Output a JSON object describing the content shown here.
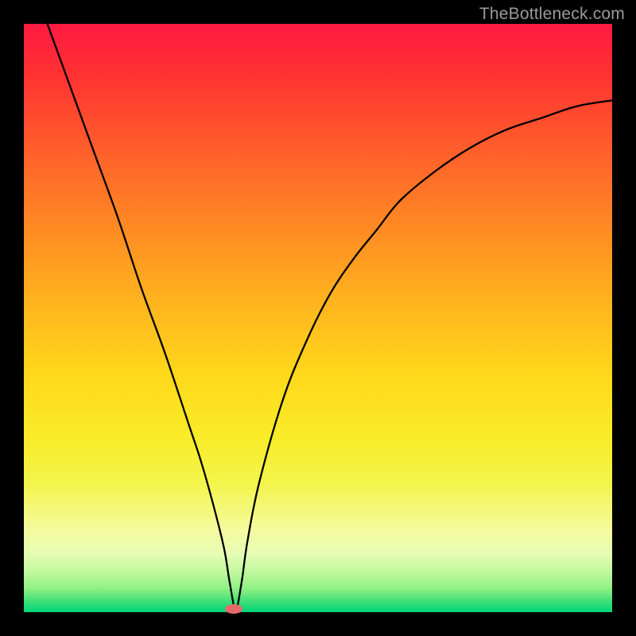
{
  "watermark": "TheBottleneck.com",
  "colors": {
    "frame": "#000000",
    "gradient_top": "#ff1a43",
    "gradient_bottom": "#00d577",
    "curve": "#000000",
    "marker": "#e46a6a",
    "watermark_text": "#9a9a9a"
  },
  "chart_data": {
    "type": "line",
    "title": "",
    "xlabel": "",
    "ylabel": "",
    "xlim": [
      0,
      100
    ],
    "ylim": [
      0,
      100
    ],
    "grid": false,
    "legend": false,
    "comment": "Values read from the image as percentage of plot area (x left→right, y bottom→top). Background color maps y=0→green, y=100→red.",
    "series": [
      {
        "name": "curve",
        "color": "#000000",
        "x": [
          4,
          8,
          12,
          16,
          20,
          24,
          28,
          30,
          32,
          34,
          35,
          36,
          37,
          38,
          40,
          44,
          48,
          52,
          56,
          60,
          64,
          70,
          76,
          82,
          88,
          94,
          100
        ],
        "y": [
          100,
          89,
          78,
          67,
          55,
          44,
          32,
          26,
          19,
          11,
          5,
          0.5,
          5,
          12,
          22,
          36,
          46,
          54,
          60,
          65,
          70,
          75,
          79,
          82,
          84,
          86,
          87
        ]
      }
    ],
    "marker": {
      "x": 35.7,
      "y": 0.5,
      "shape": "ellipse",
      "color": "#e46a6a"
    }
  }
}
